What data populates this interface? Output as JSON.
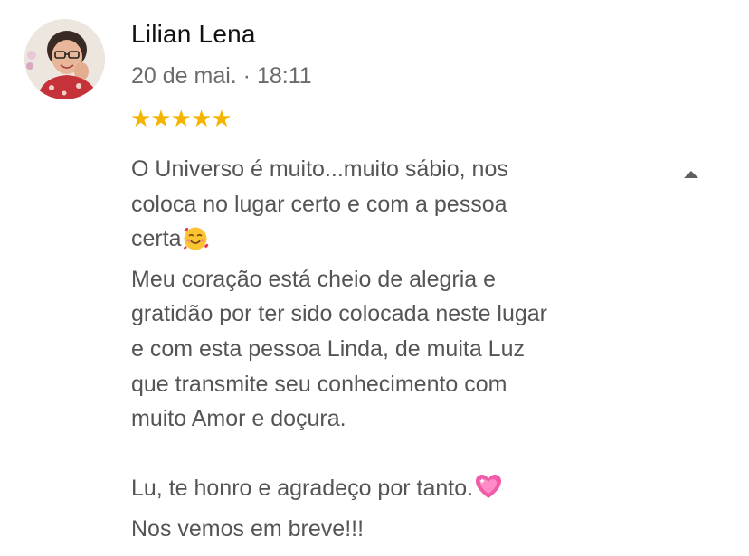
{
  "review": {
    "author": "Lilian Lena",
    "date": "20 de mai. · 18:11",
    "rating": 5,
    "rating_max": 5,
    "star_color": "#f5b400",
    "paragraphs": {
      "p1_line1": "O Universo é muito...muito sábio, nos",
      "p1_line2": "coloca no lugar certo e com a pessoa",
      "p1_line3": "certa",
      "p1_emoji": "smiling-face-with-hearts-emoji",
      "p2": "Meu coração está cheio de alegria e\ngratidão por ter sido colocada neste lugar\ne com esta pessoa Linda, de muita Luz\nque transmite seu conhecimento com\nmuito Amor e doçura.",
      "p3_line1": "Lu, te honro e agradeço por tanto.",
      "p3_emoji": "sparkling-heart-emoji",
      "p3_line2": "Nos vemos em breve!!!"
    },
    "collapse_icon": "caret-up-icon"
  }
}
